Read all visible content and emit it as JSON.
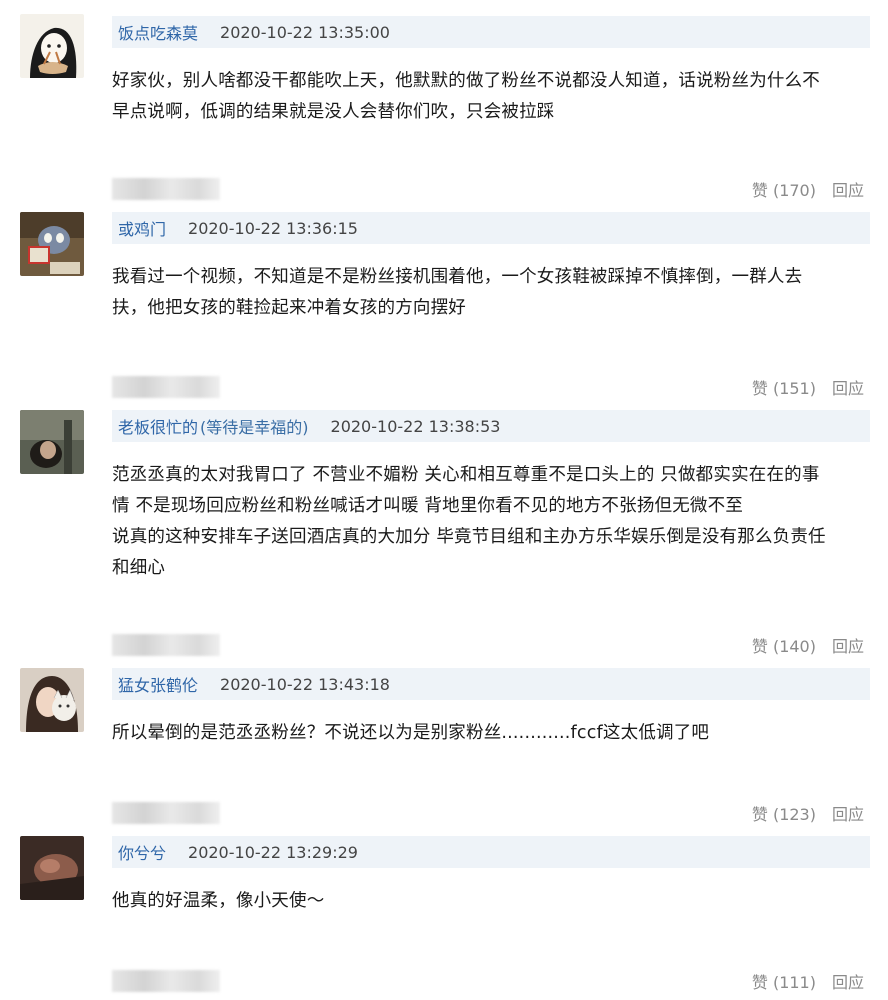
{
  "comments": [
    {
      "username": "饭点吃森莫",
      "tagline": "",
      "timestamp": "2020-10-22 13:35:00",
      "lines": [
        "好家伙，别人啥都没干都能吹上天，他默默的做了粉丝不说都没人知道，话说粉丝为什么不",
        "早点说啊，低调的结果就是没人会替你们吹，只会被拉踩"
      ],
      "like_label": "赞 (170)",
      "reply_label": "回应",
      "avatar_icon": "cartoon-girl-eating-icon"
    },
    {
      "username": "或鸡门",
      "tagline": "",
      "timestamp": "2020-10-22 13:36:15",
      "lines": [
        "我看过一个视频，不知道是不是粉丝接机围着他，一个女孩鞋被踩掉不慎摔倒，一群人去",
        "扶，他把女孩的鞋捡起来冲着女孩的方向摆好"
      ],
      "like_label": "赞 (151)",
      "reply_label": "回应",
      "avatar_icon": "cartoon-cat-reading-icon"
    },
    {
      "username": "老板很忙的",
      "tagline": "(等待是幸福的)",
      "timestamp": "2020-10-22 13:38:53",
      "lines": [
        "范丞丞真的太对我胃口了 不营业不媚粉 关心和相互尊重不是口头上的 只做都实实在在的事",
        "情 不是现场回应粉丝和粉丝喊话才叫暖 背地里你看不见的地方不张扬但无微不至",
        "说真的这种安排车子送回酒店真的大加分 毕竟节目组和主办方乐华娱乐倒是没有那么负责任",
        "和细心"
      ],
      "like_label": "赞 (140)",
      "reply_label": "回应",
      "avatar_icon": "person-photo-icon"
    },
    {
      "username": "猛女张鹤伦",
      "tagline": "",
      "timestamp": "2020-10-22 13:43:18",
      "lines": [
        "所以晕倒的是范丞丞粉丝？不说还以为是别家粉丝............fccf这太低调了吧"
      ],
      "like_label": "赞 (123)",
      "reply_label": "回应",
      "avatar_icon": "girl-with-cat-icon"
    },
    {
      "username": "你兮兮",
      "tagline": "",
      "timestamp": "2020-10-22 13:29:29",
      "lines": [
        "他真的好温柔，像小天使～"
      ],
      "like_label": "赞 (111)",
      "reply_label": "回应",
      "avatar_icon": "dark-photo-icon"
    }
  ]
}
